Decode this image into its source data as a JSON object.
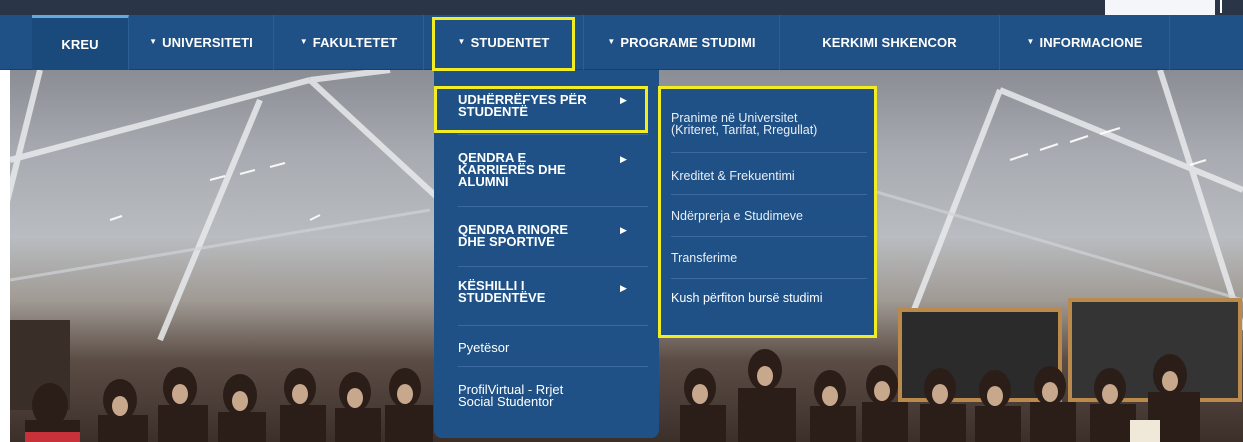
{
  "nav": {
    "items": [
      {
        "label": "KREU",
        "caret": false
      },
      {
        "label": "UNIVERSITETI",
        "caret": true
      },
      {
        "label": "FAKULTETET",
        "caret": true
      },
      {
        "label": "STUDENTET",
        "caret": true
      },
      {
        "label": "PROGRAME STUDIMI",
        "caret": true
      },
      {
        "label": "KERKIMI SHKENCOR",
        "caret": false
      },
      {
        "label": "INFORMACIONE",
        "caret": true
      }
    ],
    "caret_glyph": "▼",
    "active": "KREU"
  },
  "dropdown": {
    "items": [
      {
        "label_line1": "UDHËRRËFYES PËR",
        "label_line2": "STUDENTË",
        "has_submenu": true
      },
      {
        "label_line1": "QENDRA E",
        "label_line2": "KARRIERËS DHE",
        "label_line3": "ALUMNI",
        "has_submenu": true
      },
      {
        "label_line1": "QENDRA RINORE",
        "label_line2": "DHE SPORTIVE",
        "has_submenu": true
      },
      {
        "label_line1": "KËSHILLI I",
        "label_line2": "STUDENTËVE",
        "has_submenu": true
      },
      {
        "label_line1": "Pyetësor",
        "has_submenu": false
      },
      {
        "label_line1": "ProfilVirtual - Rrjet",
        "label_line2": "Social Studentor",
        "has_submenu": false
      }
    ],
    "arrow_glyph": "▶"
  },
  "submenu": {
    "items": [
      {
        "line1": "Pranime në Universitet",
        "line2": "(Kriteret, Tarifat, Rregullat)"
      },
      {
        "line1": "Kreditet & Frekuentimi"
      },
      {
        "line1": "Ndërprerja e Studimeve"
      },
      {
        "line1": "Transferime"
      },
      {
        "line1": "Kush përfiton bursë studimi"
      }
    ]
  },
  "colors": {
    "nav_bg": "#1f5186",
    "highlight": "#f2ec23",
    "text": "#ffffff"
  }
}
